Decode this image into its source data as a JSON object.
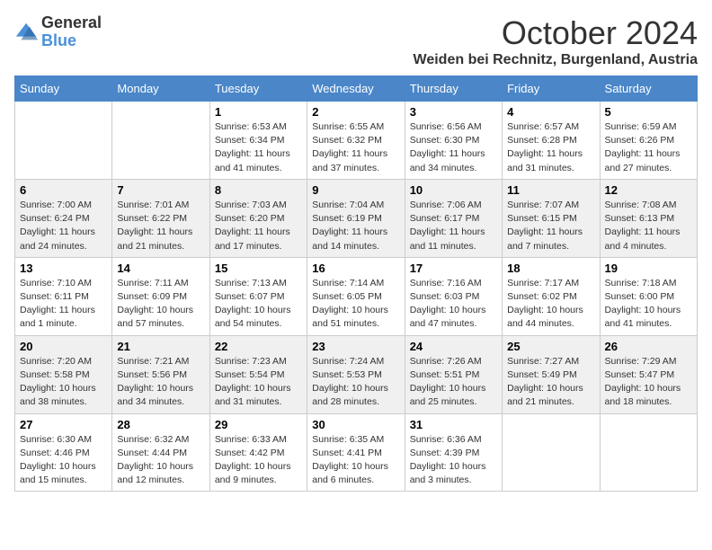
{
  "header": {
    "logo_general": "General",
    "logo_blue": "Blue",
    "month": "October 2024",
    "location": "Weiden bei Rechnitz, Burgenland, Austria"
  },
  "days_of_week": [
    "Sunday",
    "Monday",
    "Tuesday",
    "Wednesday",
    "Thursday",
    "Friday",
    "Saturday"
  ],
  "weeks": [
    [
      {
        "day": null,
        "info": null
      },
      {
        "day": null,
        "info": null
      },
      {
        "day": "1",
        "info": "Sunrise: 6:53 AM\nSunset: 6:34 PM\nDaylight: 11 hours and 41 minutes."
      },
      {
        "day": "2",
        "info": "Sunrise: 6:55 AM\nSunset: 6:32 PM\nDaylight: 11 hours and 37 minutes."
      },
      {
        "day": "3",
        "info": "Sunrise: 6:56 AM\nSunset: 6:30 PM\nDaylight: 11 hours and 34 minutes."
      },
      {
        "day": "4",
        "info": "Sunrise: 6:57 AM\nSunset: 6:28 PM\nDaylight: 11 hours and 31 minutes."
      },
      {
        "day": "5",
        "info": "Sunrise: 6:59 AM\nSunset: 6:26 PM\nDaylight: 11 hours and 27 minutes."
      }
    ],
    [
      {
        "day": "6",
        "info": "Sunrise: 7:00 AM\nSunset: 6:24 PM\nDaylight: 11 hours and 24 minutes."
      },
      {
        "day": "7",
        "info": "Sunrise: 7:01 AM\nSunset: 6:22 PM\nDaylight: 11 hours and 21 minutes."
      },
      {
        "day": "8",
        "info": "Sunrise: 7:03 AM\nSunset: 6:20 PM\nDaylight: 11 hours and 17 minutes."
      },
      {
        "day": "9",
        "info": "Sunrise: 7:04 AM\nSunset: 6:19 PM\nDaylight: 11 hours and 14 minutes."
      },
      {
        "day": "10",
        "info": "Sunrise: 7:06 AM\nSunset: 6:17 PM\nDaylight: 11 hours and 11 minutes."
      },
      {
        "day": "11",
        "info": "Sunrise: 7:07 AM\nSunset: 6:15 PM\nDaylight: 11 hours and 7 minutes."
      },
      {
        "day": "12",
        "info": "Sunrise: 7:08 AM\nSunset: 6:13 PM\nDaylight: 11 hours and 4 minutes."
      }
    ],
    [
      {
        "day": "13",
        "info": "Sunrise: 7:10 AM\nSunset: 6:11 PM\nDaylight: 11 hours and 1 minute."
      },
      {
        "day": "14",
        "info": "Sunrise: 7:11 AM\nSunset: 6:09 PM\nDaylight: 10 hours and 57 minutes."
      },
      {
        "day": "15",
        "info": "Sunrise: 7:13 AM\nSunset: 6:07 PM\nDaylight: 10 hours and 54 minutes."
      },
      {
        "day": "16",
        "info": "Sunrise: 7:14 AM\nSunset: 6:05 PM\nDaylight: 10 hours and 51 minutes."
      },
      {
        "day": "17",
        "info": "Sunrise: 7:16 AM\nSunset: 6:03 PM\nDaylight: 10 hours and 47 minutes."
      },
      {
        "day": "18",
        "info": "Sunrise: 7:17 AM\nSunset: 6:02 PM\nDaylight: 10 hours and 44 minutes."
      },
      {
        "day": "19",
        "info": "Sunrise: 7:18 AM\nSunset: 6:00 PM\nDaylight: 10 hours and 41 minutes."
      }
    ],
    [
      {
        "day": "20",
        "info": "Sunrise: 7:20 AM\nSunset: 5:58 PM\nDaylight: 10 hours and 38 minutes."
      },
      {
        "day": "21",
        "info": "Sunrise: 7:21 AM\nSunset: 5:56 PM\nDaylight: 10 hours and 34 minutes."
      },
      {
        "day": "22",
        "info": "Sunrise: 7:23 AM\nSunset: 5:54 PM\nDaylight: 10 hours and 31 minutes."
      },
      {
        "day": "23",
        "info": "Sunrise: 7:24 AM\nSunset: 5:53 PM\nDaylight: 10 hours and 28 minutes."
      },
      {
        "day": "24",
        "info": "Sunrise: 7:26 AM\nSunset: 5:51 PM\nDaylight: 10 hours and 25 minutes."
      },
      {
        "day": "25",
        "info": "Sunrise: 7:27 AM\nSunset: 5:49 PM\nDaylight: 10 hours and 21 minutes."
      },
      {
        "day": "26",
        "info": "Sunrise: 7:29 AM\nSunset: 5:47 PM\nDaylight: 10 hours and 18 minutes."
      }
    ],
    [
      {
        "day": "27",
        "info": "Sunrise: 6:30 AM\nSunset: 4:46 PM\nDaylight: 10 hours and 15 minutes."
      },
      {
        "day": "28",
        "info": "Sunrise: 6:32 AM\nSunset: 4:44 PM\nDaylight: 10 hours and 12 minutes."
      },
      {
        "day": "29",
        "info": "Sunrise: 6:33 AM\nSunset: 4:42 PM\nDaylight: 10 hours and 9 minutes."
      },
      {
        "day": "30",
        "info": "Sunrise: 6:35 AM\nSunset: 4:41 PM\nDaylight: 10 hours and 6 minutes."
      },
      {
        "day": "31",
        "info": "Sunrise: 6:36 AM\nSunset: 4:39 PM\nDaylight: 10 hours and 3 minutes."
      },
      {
        "day": null,
        "info": null
      },
      {
        "day": null,
        "info": null
      }
    ]
  ]
}
